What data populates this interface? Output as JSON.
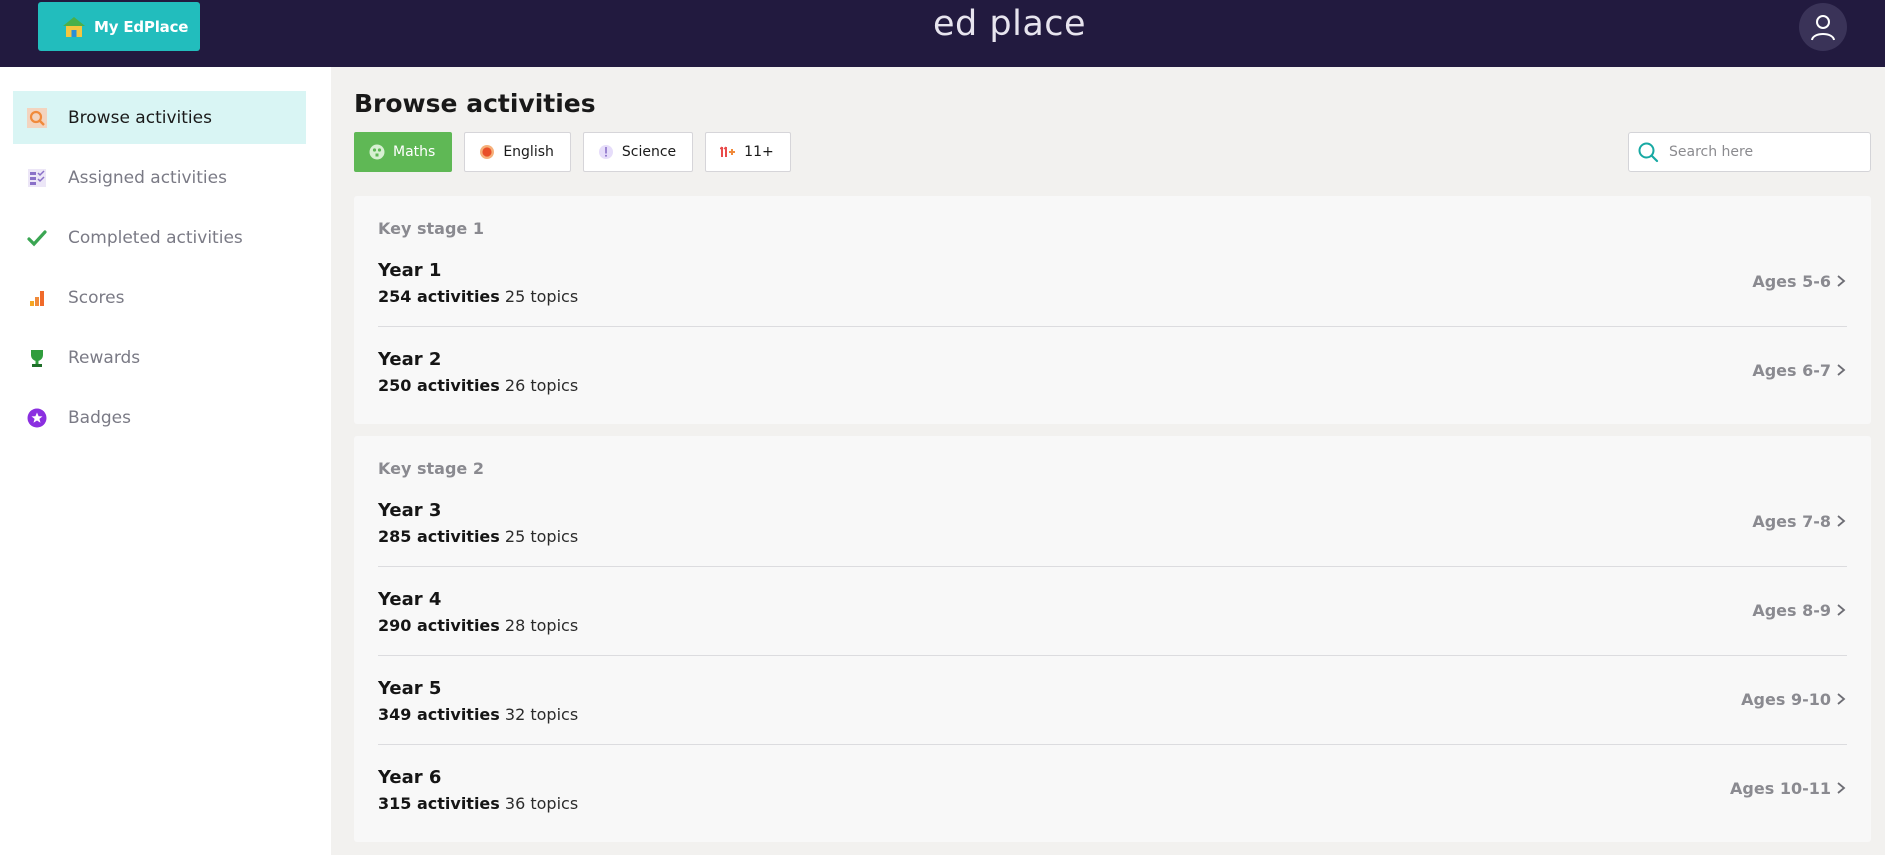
{
  "header": {
    "home_button_label": "My EdPlace",
    "logo_text": "ed place"
  },
  "sidebar": {
    "items": [
      {
        "label": "Browse activities",
        "icon": "search-icon",
        "active": true
      },
      {
        "label": "Assigned activities",
        "icon": "checklist-icon"
      },
      {
        "label": "Completed activities",
        "icon": "check-icon"
      },
      {
        "label": "Scores",
        "icon": "bar-chart-icon"
      },
      {
        "label": "Rewards",
        "icon": "trophy-icon"
      },
      {
        "label": "Badges",
        "icon": "badge-star-icon"
      }
    ]
  },
  "main": {
    "title": "Browse activities",
    "subjects": [
      {
        "label": "Maths",
        "icon": "maths-icon",
        "active": true
      },
      {
        "label": "English",
        "icon": "english-icon"
      },
      {
        "label": "Science",
        "icon": "science-icon"
      },
      {
        "label": "11+",
        "icon": "eleven-plus-icon"
      }
    ],
    "search_placeholder": "Search here",
    "stages": [
      {
        "label": "Key stage 1",
        "years": [
          {
            "title": "Year 1",
            "activities": "254 activities",
            "topics": "25 topics",
            "ages": "Ages 5-6"
          },
          {
            "title": "Year 2",
            "activities": "250 activities",
            "topics": "26 topics",
            "ages": "Ages 6-7"
          }
        ]
      },
      {
        "label": "Key stage 2",
        "years": [
          {
            "title": "Year 3",
            "activities": "285 activities",
            "topics": "25 topics",
            "ages": "Ages 7-8"
          },
          {
            "title": "Year 4",
            "activities": "290 activities",
            "topics": "28 topics",
            "ages": "Ages 8-9"
          },
          {
            "title": "Year 5",
            "activities": "349 activities",
            "topics": "32 topics",
            "ages": "Ages 9-10"
          },
          {
            "title": "Year 6",
            "activities": "315 activities",
            "topics": "36 topics",
            "ages": "Ages 10-11"
          }
        ]
      }
    ]
  },
  "colors": {
    "header_bg": "#221a3f",
    "brand_teal": "#22bdbd",
    "maths_green": "#5fb855",
    "active_nav_bg": "#d9f5f4"
  }
}
